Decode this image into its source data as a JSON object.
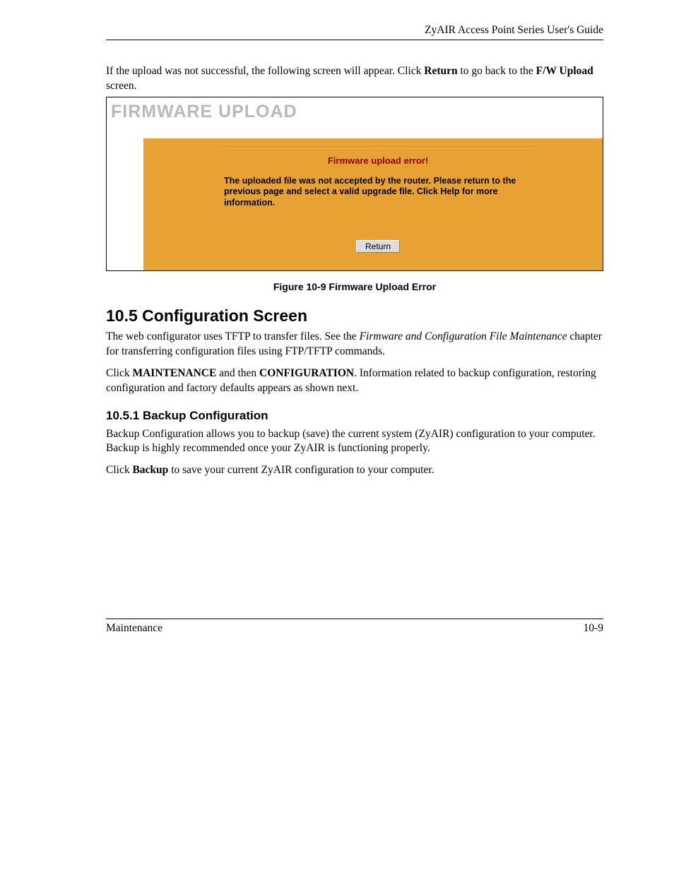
{
  "header": {
    "title": "ZyAIR Access Point Series User's Guide"
  },
  "intro": {
    "pre": "If the upload was not successful, the following screen will appear.  Click ",
    "bold1": "Return",
    "mid": " to go back to the ",
    "bold2": "F/W Upload",
    "post": " screen."
  },
  "screenshot": {
    "title": "FIRMWARE UPLOAD",
    "error_headline": "Firmware upload error!",
    "error_body": "The uploaded file was not accepted by the router. Please return to the previous page and select a valid upgrade file. Click Help for more information.",
    "button_label": "Return"
  },
  "figure_caption": "Figure 10-9 Firmware Upload Error",
  "section_105": {
    "heading": "10.5  Configuration Screen",
    "p1_pre": "The web configurator uses TFTP to transfer files. See the ",
    "p1_italic": "Firmware and Configuration File Maintenance",
    "p1_post": " chapter for transferring configuration files using FTP/TFTP commands.",
    "p2_pre": "Click ",
    "p2_b1": "MAINTENANCE",
    "p2_mid": " and then ",
    "p2_b2": "CONFIGURATION",
    "p2_post": ". Information related to backup configuration, restoring configuration and factory defaults appears as shown next."
  },
  "section_1051": {
    "heading": "10.5.1 Backup Configuration",
    "p1": "Backup Configuration allows you to backup (save) the current system (ZyAIR) configuration to your computer. Backup is highly recommended once your ZyAIR is functioning properly.",
    "p2_pre": "Click ",
    "p2_b": "Backup",
    "p2_post": " to save your current ZyAIR configuration to your computer."
  },
  "footer": {
    "left": "Maintenance",
    "right": "10-9"
  }
}
